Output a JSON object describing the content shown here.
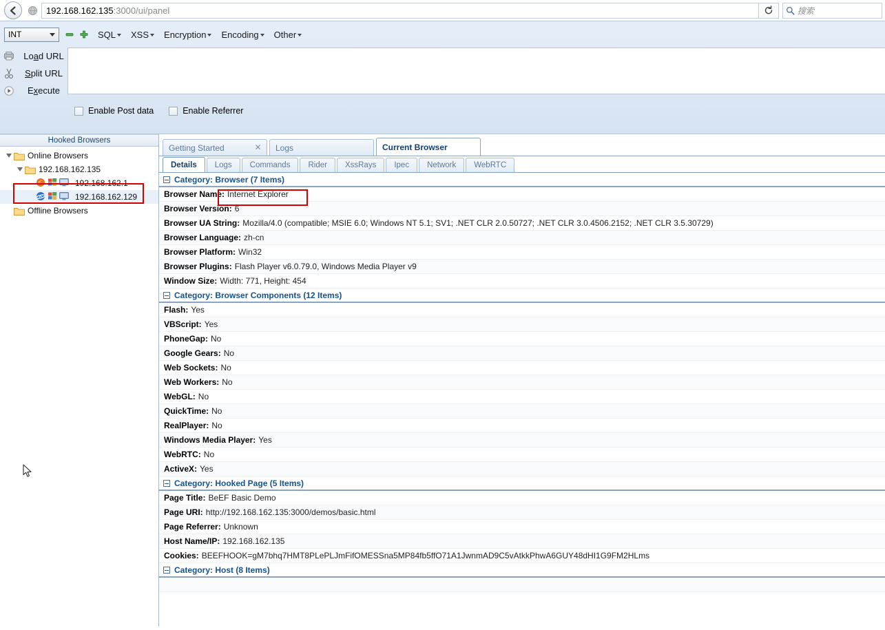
{
  "browser_chrome": {
    "back_button": "back-arrow",
    "url_host": "192.168.162.135",
    "url_path": ":3000/ui/panel",
    "reload_label": "↻",
    "search_placeholder": "搜索"
  },
  "hackbar": {
    "select_value": "INT",
    "minus_label": "−",
    "plus_label": "+",
    "menus": [
      "SQL",
      "XSS",
      "Encryption",
      "Encoding",
      "Other"
    ],
    "actions": [
      {
        "label": "Load URL",
        "icon": "load-url-icon"
      },
      {
        "label": "Split URL",
        "icon": "split-url-icon"
      },
      {
        "label": "Execute",
        "icon": "execute-icon"
      }
    ],
    "textarea_value": "",
    "checkboxes": [
      {
        "label": "Enable Post data",
        "checked": false
      },
      {
        "label": "Enable Referrer",
        "checked": false
      }
    ]
  },
  "sidebar": {
    "header": "Hooked Browsers",
    "tree": [
      {
        "label": "Online Browsers",
        "type": "folder",
        "depth": 0,
        "expanded": true
      },
      {
        "label": "192.168.162.135",
        "type": "folder",
        "depth": 1,
        "expanded": true
      },
      {
        "label": "192.168.162.1",
        "type": "browser",
        "depth": 2,
        "browser_icon": "firefox-icon",
        "selected": false
      },
      {
        "label": "192.168.162.129",
        "type": "browser",
        "depth": 2,
        "browser_icon": "ie-icon",
        "selected": true
      },
      {
        "label": "Offline Browsers",
        "type": "folder",
        "depth": 0,
        "expanded": false
      }
    ]
  },
  "outer_tabs": [
    {
      "label": "Getting Started",
      "active": false,
      "closable": true
    },
    {
      "label": "Logs",
      "active": false,
      "closable": false
    },
    {
      "label": "Current Browser",
      "active": true,
      "closable": false
    }
  ],
  "inner_tabs": [
    {
      "label": "Details",
      "active": true
    },
    {
      "label": "Logs",
      "active": false
    },
    {
      "label": "Commands",
      "active": false
    },
    {
      "label": "Rider",
      "active": false
    },
    {
      "label": "XssRays",
      "active": false
    },
    {
      "label": "Ipec",
      "active": false
    },
    {
      "label": "Network",
      "active": false
    },
    {
      "label": "WebRTC",
      "active": false
    }
  ],
  "categories": [
    {
      "title": "Category: Browser (7 Items)",
      "rows": [
        {
          "key": "Browser Name:",
          "value": "Internet Explorer"
        },
        {
          "key": "Browser Version:",
          "value": "6"
        },
        {
          "key": "Browser UA String:",
          "value": "Mozilla/4.0 (compatible; MSIE 6.0; Windows NT 5.1; SV1; .NET CLR 2.0.50727; .NET CLR 3.0.4506.2152; .NET CLR 3.5.30729)"
        },
        {
          "key": "Browser Language:",
          "value": "zh-cn"
        },
        {
          "key": "Browser Platform:",
          "value": "Win32"
        },
        {
          "key": "Browser Plugins:",
          "value": "Flash Player v6.0.79.0, Windows Media Player v9"
        },
        {
          "key": "Window Size:",
          "value": "Width: 771, Height: 454"
        }
      ]
    },
    {
      "title": "Category: Browser Components (12 Items)",
      "rows": [
        {
          "key": "Flash:",
          "value": "Yes"
        },
        {
          "key": "VBScript:",
          "value": "Yes"
        },
        {
          "key": "PhoneGap:",
          "value": "No"
        },
        {
          "key": "Google Gears:",
          "value": "No"
        },
        {
          "key": "Web Sockets:",
          "value": "No"
        },
        {
          "key": "Web Workers:",
          "value": "No"
        },
        {
          "key": "WebGL:",
          "value": "No"
        },
        {
          "key": "QuickTime:",
          "value": "No"
        },
        {
          "key": "RealPlayer:",
          "value": "No"
        },
        {
          "key": "Windows Media Player:",
          "value": "Yes"
        },
        {
          "key": "WebRTC:",
          "value": "No"
        },
        {
          "key": "ActiveX:",
          "value": "Yes"
        }
      ]
    },
    {
      "title": "Category: Hooked Page (5 Items)",
      "rows": [
        {
          "key": "Page Title:",
          "value": "BeEF Basic Demo"
        },
        {
          "key": "Page URI:",
          "value": "http://192.168.162.135:3000/demos/basic.html"
        },
        {
          "key": "Page Referrer:",
          "value": "Unknown"
        },
        {
          "key": "Host Name/IP:",
          "value": "192.168.162.135"
        },
        {
          "key": "Cookies:",
          "value": "BEEFHOOK=gM7bhq7HMT8PLePLJmFifOMESSna5MP84fb5ffO71A1JwnmAD9C5vAtkkPhwA6GUY48dHI1G9FM2HLms"
        }
      ]
    },
    {
      "title": "Category: Host (8 Items)",
      "rows": []
    }
  ],
  "colors": {
    "highlight_red": "#d40000",
    "heading_blue": "#15528f",
    "tab_active_text": "#123f70",
    "toolbar_bg": "#dce8f5"
  }
}
